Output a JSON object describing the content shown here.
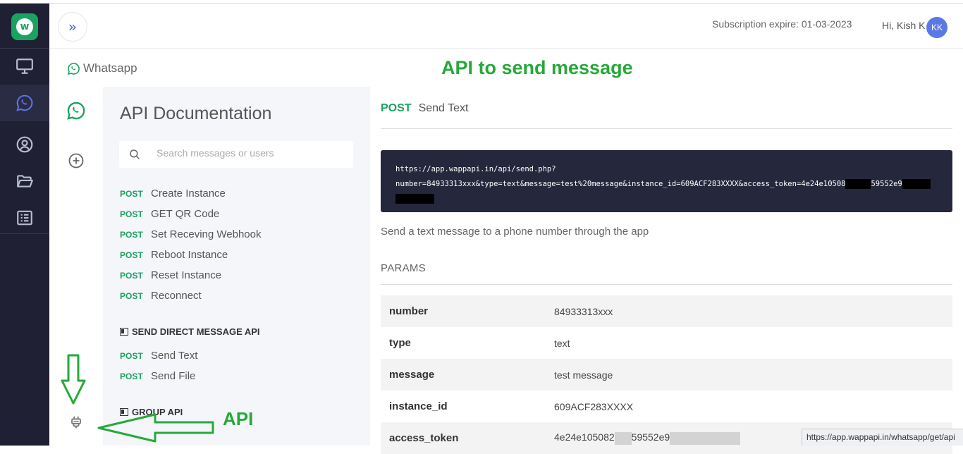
{
  "header": {
    "subscription": "Subscription expire: 01-03-2023",
    "greeting": "Hi, Kish K",
    "avatar_initials": "KK"
  },
  "subheader": {
    "breadcrumb": "Whatsapp",
    "annotation_title": "API to send message"
  },
  "sidebar": {
    "title": "API Documentation",
    "search_placeholder": "Search messages or users",
    "endpoints": [
      {
        "method": "POST",
        "label": "Create Instance"
      },
      {
        "method": "POST",
        "label": "GET QR Code"
      },
      {
        "method": "POST",
        "label": "Set Receving Webhook"
      },
      {
        "method": "POST",
        "label": "Reboot Instance"
      },
      {
        "method": "POST",
        "label": "Reset Instance"
      },
      {
        "method": "POST",
        "label": "Reconnect"
      }
    ],
    "section_direct": "SEND DIRECT MESSAGE API",
    "direct_endpoints": [
      {
        "method": "POST",
        "label": "Send Text"
      },
      {
        "method": "POST",
        "label": "Send File"
      }
    ],
    "section_group": "GROUP API",
    "annotation_api": "API"
  },
  "main": {
    "method": "POST",
    "name": "Send Text",
    "url_line1": "https://app.wappapi.in/api/send.php?",
    "url_line2a": "number=84933313xxx&type=text&message=test%20message&instance_id=609ACF283XXXX&access_token=4e24e10508",
    "url_line2b": "59552e9",
    "description": "Send a text message to a phone number through the app",
    "params_label": "PARAMS",
    "params": [
      {
        "key": "number",
        "value": "84933313xxx"
      },
      {
        "key": "type",
        "value": "text"
      },
      {
        "key": "message",
        "value": "test message"
      },
      {
        "key": "instance_id",
        "value": "609ACF283XXXX"
      }
    ],
    "token_key": "access_token",
    "token_value_a": "4e24e105082",
    "token_value_b": "59552e9"
  },
  "statusbar": "https://app.wappapi.in/whatsapp/get/api",
  "colors": {
    "rail": "#1f2033",
    "accent_green": "#1aa261",
    "annotation_green": "#27a83a",
    "avatar": "#5b79e6"
  }
}
